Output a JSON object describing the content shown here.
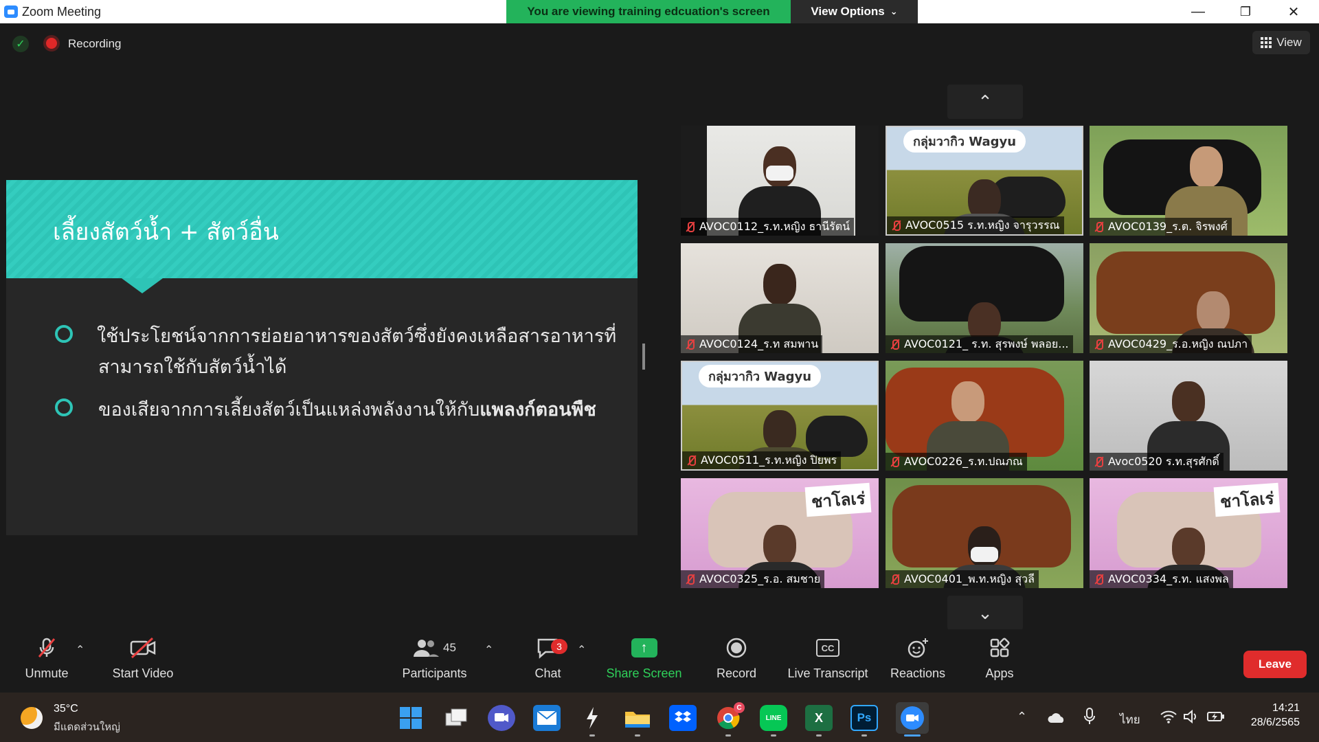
{
  "window": {
    "title": "Zoom Meeting",
    "share_banner": "You are viewing training edcuation's screen",
    "view_options": "View Options",
    "controls": [
      "minimize",
      "maximize",
      "close"
    ]
  },
  "meeting_bar": {
    "recording_label": "Recording",
    "view_label": "View"
  },
  "slide": {
    "title": "เลี้ยงสัตว์น้ำ + สัตว์อื่น",
    "bullets": [
      {
        "line1": "ใช้ประโยชน์จากการย่อยอาหารของสัตว์ซึ่งยังคงเหลือสารอาหารที่",
        "line2": "สามารถใช้กับสัตว์น้ำได้"
      },
      {
        "text": "ของเสียจากการเลี้ยงสัตว์เป็นแหล่งพลังงานให้กับ",
        "bold": "แพลงก์ตอนพืช"
      }
    ],
    "accent_color": "#2ec4b6"
  },
  "gallery": {
    "participants": [
      {
        "name": "AVOC0112_ร.ท.หญิง ธานีรัตน์"
      },
      {
        "name": "AVOC0515 ร.ท.หญิง จารุวรรณ",
        "banner": "กลุ่มวากิว Wagyu"
      },
      {
        "name": "AVOC0139_ร.ต. จิรพงศ์"
      },
      {
        "name": "AVOC0124_ร.ท สมพาน"
      },
      {
        "name": "AVOC0121_ ร.ท. สุรพงษ์ พลอย..."
      },
      {
        "name": "AVOC0429_ร.อ.หญิง ณปภา"
      },
      {
        "name": "AVOC0511_ร.ท.หญิง ปิยพร",
        "banner": "กลุ่มวากิว Wagyu"
      },
      {
        "name": "AVOC0226_ร.ท.ปณภณ"
      },
      {
        "name": "Avoc0520 ร.ท.สุรศักดิ์"
      },
      {
        "name": "AVOC0325_ร.อ. สมชาย",
        "sign": "ชาโลเร่"
      },
      {
        "name": "AVOC0401_พ.ท.หญิง สุวลี"
      },
      {
        "name": "AVOC0334_ร.ท. แสงพล",
        "sign": "ชาโลเร่"
      }
    ]
  },
  "toolbar": {
    "unmute": "Unmute",
    "start_video": "Start Video",
    "participants": "Participants",
    "participants_count": "45",
    "chat": "Chat",
    "chat_badge": "3",
    "share_screen": "Share Screen",
    "record": "Record",
    "live_transcript": "Live Transcript",
    "cc_icon": "CC",
    "reactions": "Reactions",
    "apps": "Apps",
    "leave": "Leave"
  },
  "taskbar": {
    "temperature": "35°C",
    "weather_desc": "มีแดดส่วนใหญ่",
    "language": "ไทย",
    "time": "14:21",
    "date": "28/6/2565",
    "excel_icon": "X",
    "ps_icon": "Ps",
    "line_icon": "LINE",
    "chrome_badge": "C"
  }
}
